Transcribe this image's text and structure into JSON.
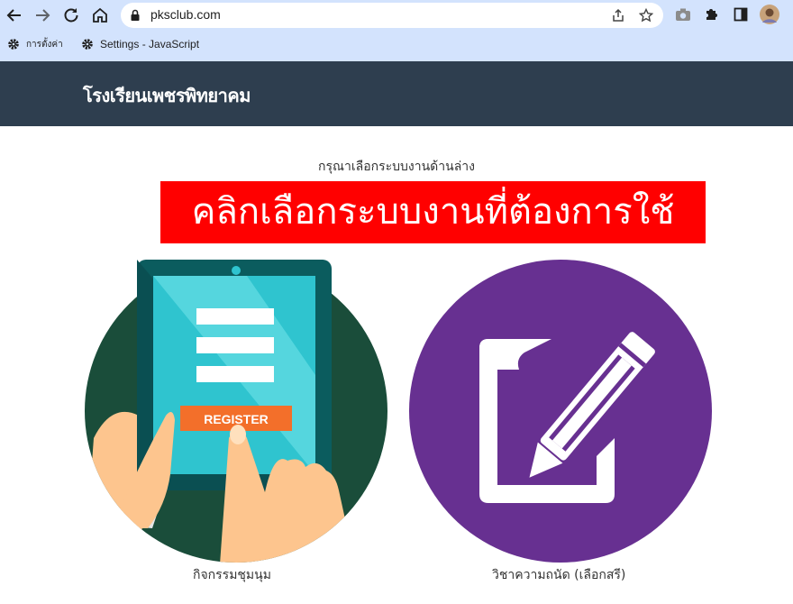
{
  "browser": {
    "url": "pksclub.com",
    "bookmarks": [
      {
        "label": "การตั้งค่า"
      },
      {
        "label": "Settings - JavaScript"
      }
    ]
  },
  "site": {
    "title": "โรงเรียนเพชรพิทยาคม"
  },
  "main": {
    "instruction": "กรุณาเลือกระบบงานด้านล่าง",
    "banner": "คลิกเลือกระบบงานที่ต้องการใช้",
    "banner_color": "#ff0000",
    "cards": [
      {
        "label": "กิจกรรมชุมนุม",
        "image_text": "REGISTER",
        "icon": "register-tablet-illustration"
      },
      {
        "label": "วิชาความถนัด (เลือกสรี)",
        "icon": "document-pencil-icon"
      }
    ]
  },
  "colors": {
    "header_bg": "#2e3e4f",
    "browser_bg": "#d3e3fd",
    "purple": "#673091",
    "dark_green": "#1a4d3a"
  }
}
